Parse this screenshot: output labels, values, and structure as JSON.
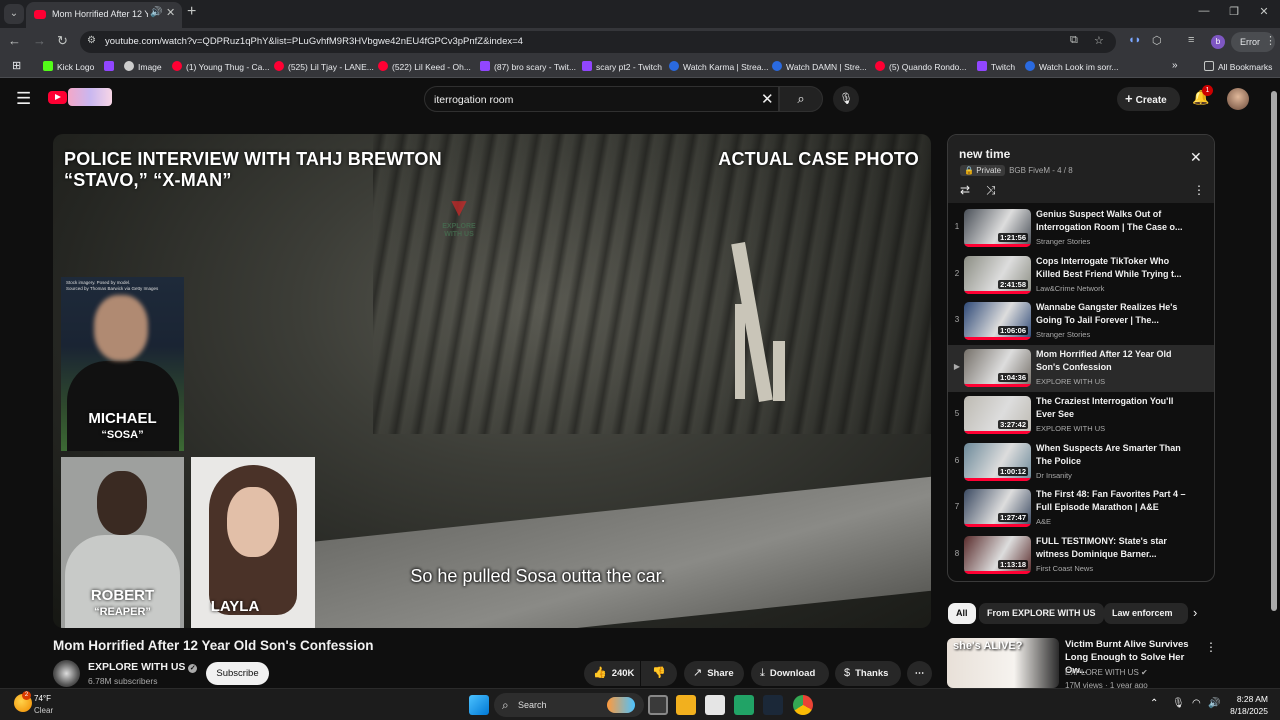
{
  "browser": {
    "tab_title": "Mom Horrified After 12 Year Old Son's Confession",
    "url": "youtube.com/watch?v=QDPRuz1qPhY&list=PLuGvhfM9R3HVbgwe42nEU4fGPCv3pPnfZ&index=4",
    "profile_initial": "b",
    "error_label": "Error",
    "bookmarks": [
      {
        "label": "Kick Logo",
        "color": "#53fc18"
      },
      {
        "label": "",
        "color": "#9146ff"
      },
      {
        "label": "Image",
        "color": "#cccccc"
      },
      {
        "label": "(1) Young Thug - Ca...",
        "color": "#ff0033"
      },
      {
        "label": "(525) Lil Tjay - LANE...",
        "color": "#ff0033"
      },
      {
        "label": "(522) Lil Keed - Oh...",
        "color": "#ff0033"
      },
      {
        "label": "(87) bro scary - Twit...",
        "color": "#9146ff"
      },
      {
        "label": "scary pt2 - Twitch",
        "color": "#9146ff"
      },
      {
        "label": "Watch Karma | Strea...",
        "color": "#2a6ae0"
      },
      {
        "label": "Watch DAMN | Stre...",
        "color": "#2a6ae0"
      },
      {
        "label": "(5) Quando Rondo...",
        "color": "#ff0033"
      },
      {
        "label": "Twitch",
        "color": "#9146ff"
      },
      {
        "label": "Watch Look im sorr...",
        "color": "#2a6ae0"
      }
    ],
    "all_bookmarks": "All Bookmarks"
  },
  "youtube": {
    "search_query": "iterrogation room",
    "create_label": "Create",
    "notification_count": "1"
  },
  "video": {
    "overlay_left": [
      "POLICE INTERVIEW WITH TAHJ BREWTON",
      "“STAVO,” “X-MAN”"
    ],
    "overlay_right": "ACTUAL CASE PHOTO",
    "watermark": [
      "EXPLORE",
      "WITH US"
    ],
    "photo_caption": [
      "Stock imagery. Posed by model.",
      "Sourced by Thomas Barwick via Getty Images"
    ],
    "people": [
      {
        "name": "MICHAEL",
        "alias": "“SOSA”"
      },
      {
        "name": "ROBERT",
        "alias": "“REAPER”"
      },
      {
        "name": "LAYLA",
        "alias": ""
      }
    ],
    "subtitle": "So he pulled Sosa outta the car.",
    "title": "Mom Horrified After 12 Year Old Son's Confession",
    "channel": "EXPLORE WITH US",
    "subscribers": "6.78M subscribers",
    "subscribe_label": "Subscribe",
    "likes": "240K",
    "share_label": "Share",
    "download_label": "Download",
    "thanks_label": "Thanks"
  },
  "playlist": {
    "title": "new time",
    "privacy": "Private",
    "owner_position": "BGB FiveM - 4 / 8",
    "items": [
      {
        "index": "1",
        "title": "Genius Suspect Walks Out of Interrogation Room | The Case o...",
        "channel": "Stranger Stories",
        "duration": "1:21:56",
        "active": false,
        "color": "#4a5058"
      },
      {
        "index": "2",
        "title": "Cops Interrogate TikToker Who Killed Best Friend While Trying t...",
        "channel": "Law&Crime Network",
        "duration": "2:41:58",
        "active": false,
        "color": "#8c8e84"
      },
      {
        "index": "3",
        "title": "Wannabe Gangster Realizes He's Going To Jail Forever | The...",
        "channel": "Stranger Stories",
        "duration": "1:06:06",
        "active": false,
        "color": "#2f4a78"
      },
      {
        "index": "▶",
        "title": "Mom Horrified After 12 Year Old Son's Confession",
        "channel": "EXPLORE WITH US",
        "duration": "1:04:36",
        "active": true,
        "color": "#76716a"
      },
      {
        "index": "5",
        "title": "The Craziest Interrogation You'll Ever See",
        "channel": "EXPLORE WITH US",
        "duration": "3:27:42",
        "active": false,
        "color": "#bdbab2"
      },
      {
        "index": "6",
        "title": "When Suspects Are Smarter Than The Police",
        "channel": "Dr Insanity",
        "duration": "1:00:12",
        "active": false,
        "color": "#6d8a9a"
      },
      {
        "index": "7",
        "title": "The First 48: Fan Favorites Part 4 – Full Episode Marathon | A&E",
        "channel": "A&E",
        "duration": "1:27:47",
        "active": false,
        "color": "#3b4a62"
      },
      {
        "index": "8",
        "title": "FULL TESTIMONY: State's star witness Dominique Barner...",
        "channel": "First Coast News",
        "duration": "1:13:18",
        "active": false,
        "color": "#5a2c2c"
      }
    ]
  },
  "chips": [
    "All",
    "From EXPLORE WITH US",
    "Law enforcem"
  ],
  "recommendation": {
    "thumb_text": "she's ALIVE?",
    "title": "Victim Burnt Alive Survives Long Enough to Solve Her Ow...",
    "channel": "EXPLORE WITH US",
    "meta": "17M views · 1 year ago"
  },
  "taskbar": {
    "temperature": "74°F",
    "condition": "Clear",
    "weather_badge": "2",
    "search_label": "Search",
    "time": "8:28 AM",
    "date": "8/18/2025"
  }
}
